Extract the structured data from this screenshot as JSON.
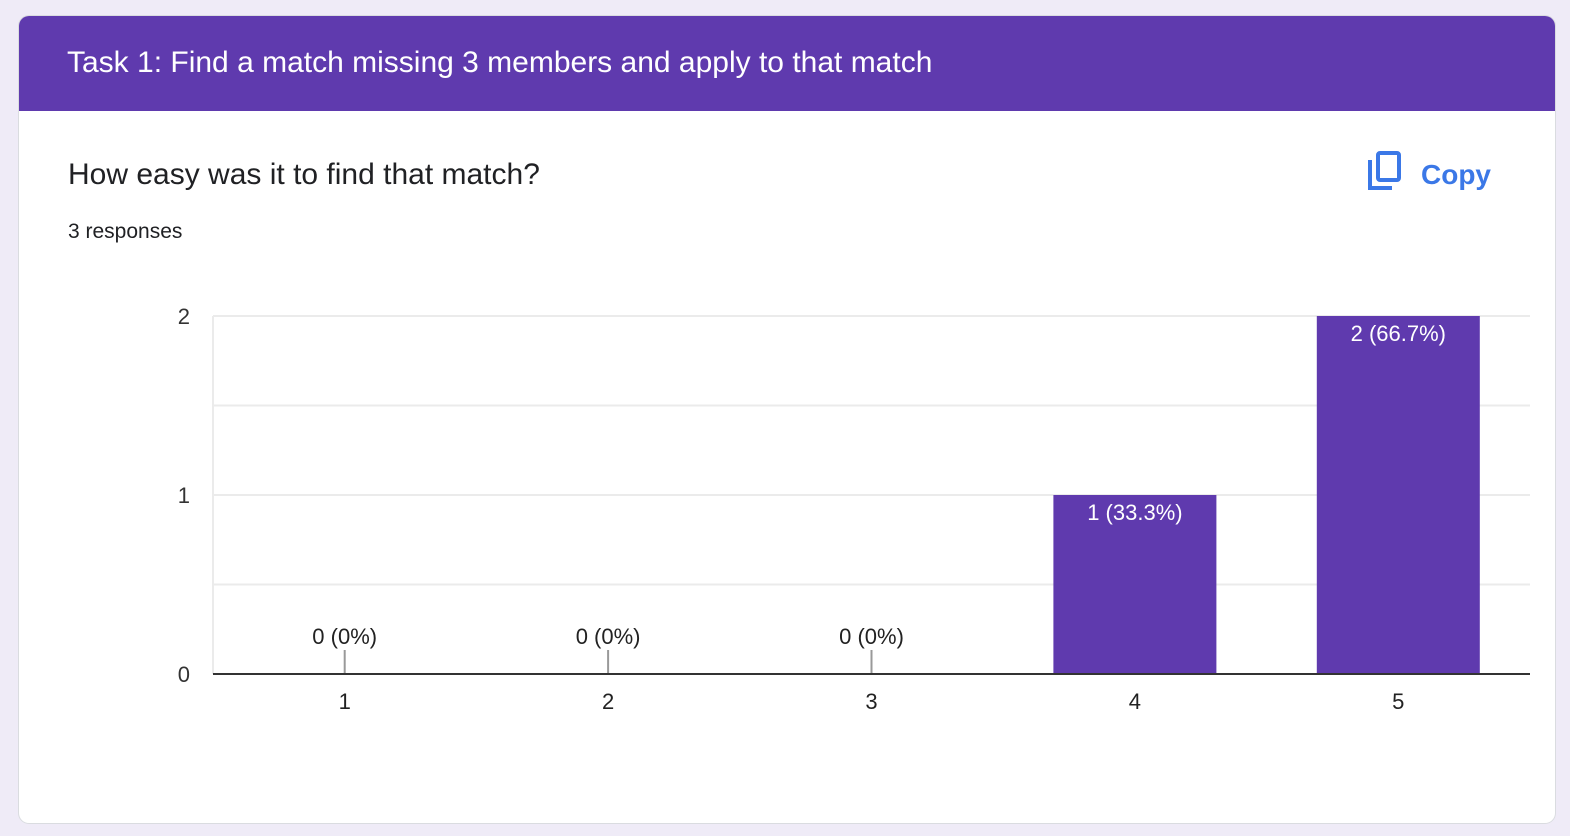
{
  "section_title": "Task 1: Find a match missing 3 members and apply to that match",
  "question": "How easy was it to find that match?",
  "responses": "3 responses",
  "copy_button": {
    "label": "Copy",
    "icon": "copy-icon"
  },
  "colors": {
    "header": "#5f3aae",
    "bar": "#5f3aae",
    "accent": "#3b78e7",
    "background": "#efebf7"
  },
  "chart_data": {
    "type": "bar",
    "categories": [
      "1",
      "2",
      "3",
      "4",
      "5"
    ],
    "values": [
      0,
      0,
      0,
      1,
      2
    ],
    "data_labels": [
      "0 (0%)",
      "0 (0%)",
      "0 (0%)",
      "1 (33.3%)",
      "2 (66.7%)"
    ],
    "y_ticks": [
      "0",
      "1",
      "2"
    ],
    "ylim": [
      0,
      2
    ],
    "grid": true,
    "title": "",
    "xlabel": "",
    "ylabel": ""
  }
}
